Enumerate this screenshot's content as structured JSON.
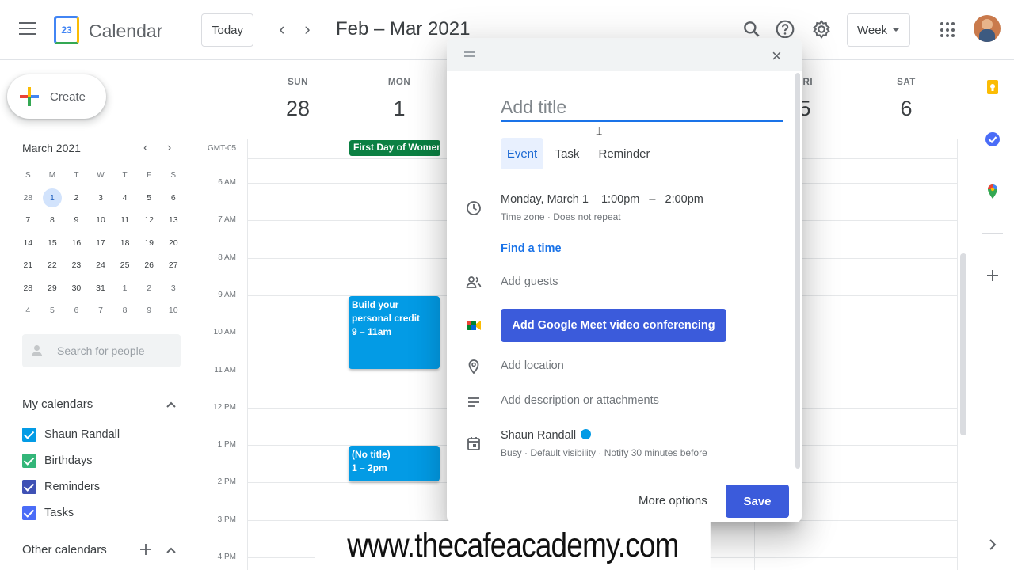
{
  "header": {
    "app_title": "Calendar",
    "logo_number": "23",
    "today_label": "Today",
    "prev": "‹",
    "next": "›",
    "date_range": "Feb – Mar 2021",
    "view": "Week"
  },
  "sidebar": {
    "create_label": "Create",
    "mini_calendar": {
      "title": "March 2021",
      "weekdays": [
        "S",
        "M",
        "T",
        "W",
        "T",
        "F",
        "S"
      ],
      "weeks": [
        [
          "28",
          "1",
          "2",
          "3",
          "4",
          "5",
          "6"
        ],
        [
          "7",
          "8",
          "9",
          "10",
          "11",
          "12",
          "13"
        ],
        [
          "14",
          "15",
          "16",
          "17",
          "18",
          "19",
          "20"
        ],
        [
          "21",
          "22",
          "23",
          "24",
          "25",
          "26",
          "27"
        ],
        [
          "28",
          "29",
          "30",
          "31",
          "1",
          "2",
          "3"
        ],
        [
          "4",
          "5",
          "6",
          "7",
          "8",
          "9",
          "10"
        ]
      ],
      "selected": "1"
    },
    "search_placeholder": "Search for people",
    "my_calendars_title": "My calendars",
    "my_calendars": [
      {
        "label": "Shaun Randall",
        "color": "#039be5"
      },
      {
        "label": "Birthdays",
        "color": "#33b679"
      },
      {
        "label": "Reminders",
        "color": "#3f51b5"
      },
      {
        "label": "Tasks",
        "color": "#4a6cf7"
      }
    ],
    "other_calendars_title": "Other calendars"
  },
  "grid": {
    "timezone": "GMT-05",
    "days": [
      {
        "dow": "SUN",
        "num": "28"
      },
      {
        "dow": "MON",
        "num": "1"
      },
      {
        "dow": "FRI",
        "num": "5"
      },
      {
        "dow": "SAT",
        "num": "6"
      }
    ],
    "times": [
      "6 AM",
      "7 AM",
      "8 AM",
      "9 AM",
      "10 AM",
      "11 AM",
      "12 PM",
      "1 PM",
      "2 PM",
      "3 PM",
      "4 PM"
    ],
    "allday_event": "First Day of Women'",
    "events": [
      {
        "title": "Build your personal credit",
        "time": "9 – 11am"
      },
      {
        "title": "(No title)",
        "time": "1 – 2pm"
      }
    ]
  },
  "dialog": {
    "title_placeholder": "Add title",
    "tabs": [
      "Event",
      "Task",
      "Reminder"
    ],
    "active_tab": "Event",
    "date": "Monday, March 1",
    "start": "1:00pm",
    "dash": "–",
    "end": "2:00pm",
    "timezone_note": "Time zone · Does not repeat",
    "find_time": "Find a time",
    "add_guests": "Add guests",
    "meet_button": "Add Google Meet video conferencing",
    "add_location": "Add location",
    "add_description": "Add description or attachments",
    "calendar_owner": "Shaun Randall",
    "calendar_details": "Busy · Default visibility · Notify 30 minutes before",
    "more_options": "More options",
    "save": "Save",
    "close": "×"
  },
  "watermark": "www.thecafeacademy.com",
  "colors": {
    "accent": "#1a73e8",
    "event_blue": "#039be5",
    "holiday_green": "#0b8043",
    "save_blue": "#3b5bdb"
  },
  "icons": [
    "menu-icon",
    "search-icon",
    "help-icon",
    "settings-icon",
    "apps-icon",
    "clock-icon",
    "people-icon",
    "meet-icon",
    "location-icon",
    "description-icon",
    "calendar-icon",
    "keep-icon",
    "tasks-icon",
    "maps-icon",
    "add-icon"
  ]
}
